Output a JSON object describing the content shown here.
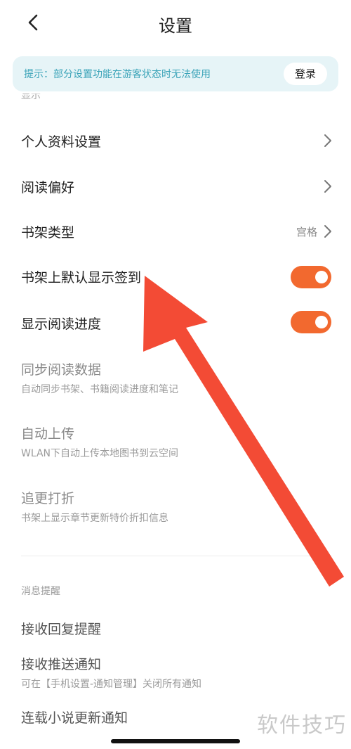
{
  "header": {
    "title": "设置",
    "back_icon": "chevron-left-icon"
  },
  "notice": {
    "text": "提示：部分设置功能在游客状态时无法使用",
    "login_label": "登录"
  },
  "section_top": {
    "label": "显示"
  },
  "general_items": [
    {
      "label": "个人资料设置",
      "control": "chevron"
    },
    {
      "label": "阅读偏好",
      "control": "chevron"
    },
    {
      "label": "书架类型",
      "value": "宫格",
      "control": "chevron"
    },
    {
      "label": "书架上默认显示签到",
      "control": "toggle",
      "on": true
    },
    {
      "label": "显示阅读进度",
      "control": "toggle",
      "on": true
    },
    {
      "label": "同步阅读数据",
      "sub": "自动同步书架、书籍阅读进度和笔记"
    },
    {
      "label": "自动上传",
      "sub": "WLAN下自动上传本地图书到云空间"
    },
    {
      "label": "追更打折",
      "sub": "书架上显示章节更新特价折扣信息"
    }
  ],
  "messages_section": {
    "label": "消息提醒",
    "items": [
      {
        "label": "接收回复提醒"
      },
      {
        "label": "接收推送通知",
        "sub": "可在【手机设置-通知管理】关闭所有通知"
      },
      {
        "label": "连载小说更新通知"
      }
    ]
  },
  "watermark": "软件技巧",
  "colors": {
    "accent": "#f2692f",
    "notice_bg": "#e6f4f7",
    "notice_text": "#3aa3b8",
    "annotation_arrow": "#f2412a"
  }
}
